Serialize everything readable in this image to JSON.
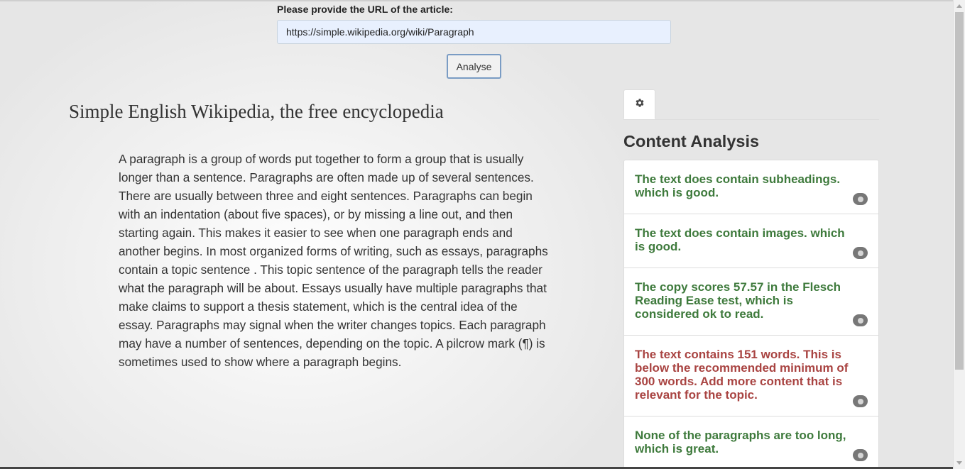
{
  "form": {
    "url_label": "Please provide the URL of the article:",
    "url_value": "https://simple.wikipedia.org/wiki/Paragraph",
    "analyse_label": "Analyse"
  },
  "article": {
    "site_title": "Simple English Wikipedia, the free encyclopedia",
    "body": "A paragraph is a group of words put together to form a group that is usually longer than a sentence. Paragraphs are often made up of several sentences. There are usually between three and eight sentences. Paragraphs can begin with an indentation (about five spaces), or by missing a line out, and then starting again. This makes it easier to see when one paragraph ends and another begins. In most organized forms of writing, such as essays, paragraphs contain a topic sentence . This topic sentence of the paragraph tells the reader what the paragraph will be about. Essays usually have multiple paragraphs that make claims to support a thesis statement, which is the central idea of the essay. Paragraphs may signal when the writer changes topics. Each paragraph may have a number of sentences, depending on the topic. A pilcrow mark (¶) is sometimes used to show where a paragraph begins."
  },
  "panel": {
    "settings_tab_icon": "gear-icon",
    "heading": "Content Analysis",
    "items": [
      {
        "text": "The text does contain subheadings. which is good.",
        "status": "good",
        "color": "#3e7a3c"
      },
      {
        "text": "The text does contain images. which is good.",
        "status": "good",
        "color": "#3e7a3c"
      },
      {
        "text": "The copy scores 57.57 in the Flesch Reading Ease test, which is considered ok to read.",
        "status": "good",
        "color": "#3e7a3c"
      },
      {
        "text": "The text contains 151 words. This is below the recommended minimum of 300 words. Add more content that is relevant for the topic.",
        "status": "bad",
        "color": "#a94442"
      },
      {
        "text": "None of the paragraphs are too long, which is great.",
        "status": "good",
        "color": "#3e7a3c"
      }
    ],
    "item_icon": "comment-icon"
  },
  "colors": {
    "good": "#3e7a3c",
    "bad": "#a94442",
    "button_border": "#7a9cc4",
    "input_bg": "#e8f0fe"
  }
}
